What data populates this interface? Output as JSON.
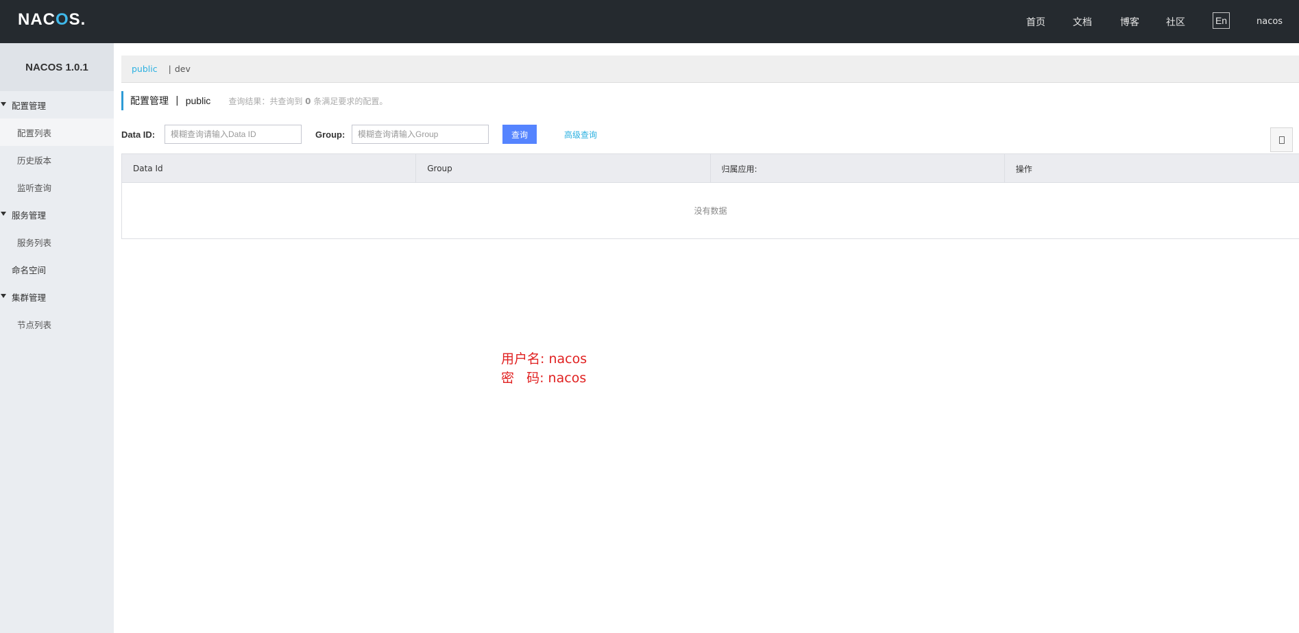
{
  "header": {
    "logo_left": "NAC",
    "logo_o": "O",
    "logo_right": "S.",
    "nav": [
      "首页",
      "文档",
      "博客",
      "社区"
    ],
    "lang": "En",
    "user": "nacos"
  },
  "sidebar": {
    "title": "NACOS 1.0.1",
    "groups": [
      {
        "label": "配置管理",
        "items": [
          "配置列表",
          "历史版本",
          "监听查询"
        ]
      },
      {
        "label": "服务管理",
        "items": [
          "服务列表"
        ]
      },
      {
        "label": "命名空间",
        "items": []
      },
      {
        "label": "集群管理",
        "items": [
          "节点列表"
        ]
      }
    ],
    "active_item": "配置列表"
  },
  "namespace_bar": {
    "active": "public",
    "separator": "|",
    "other": "dev"
  },
  "page_title": {
    "main": "配置管理",
    "pipe": "|",
    "namespace": "public",
    "result_prefix": "查询结果：共查询到",
    "result_count": "0",
    "result_suffix": "条满足要求的配置。"
  },
  "search": {
    "data_id_label": "Data ID:",
    "data_id_placeholder": "模糊查询请输入Data ID",
    "group_label": "Group:",
    "group_placeholder": "模糊查询请输入Group",
    "query_button": "查询",
    "advanced_link": "高级查询"
  },
  "table": {
    "columns": [
      "Data Id",
      "Group",
      "归属应用:",
      "操作"
    ],
    "empty_text": "没有数据"
  },
  "note": {
    "line1": "用户名: nacos",
    "line2": "密   码: nacos"
  },
  "colors": {
    "topbar": "#252a2f",
    "accent": "#2bb0e0",
    "primary_button": "#5584ff",
    "note": "#e02020"
  }
}
